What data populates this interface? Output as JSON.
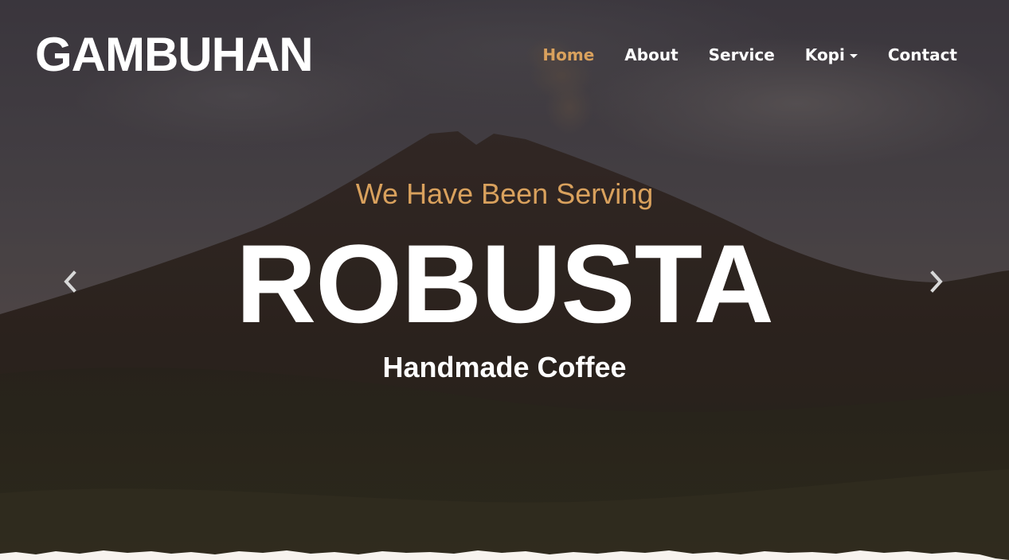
{
  "header": {
    "brand": "GAMBUHAN",
    "nav": {
      "home": "Home",
      "about": "About",
      "service": "Service",
      "kopi": "Kopi",
      "contact": "Contact"
    },
    "active_item": "Home"
  },
  "hero": {
    "tagline": "We Have Been Serving",
    "headline": "ROBUSTA",
    "subline": "Handmade Coffee"
  },
  "icons": {
    "prev": "chevron-left-icon",
    "next": "chevron-right-icon",
    "dropdown": "caret-down-icon"
  },
  "colors": {
    "accent": "#d9a15d",
    "text": "#ffffff",
    "paper": "#f7f3ee"
  }
}
